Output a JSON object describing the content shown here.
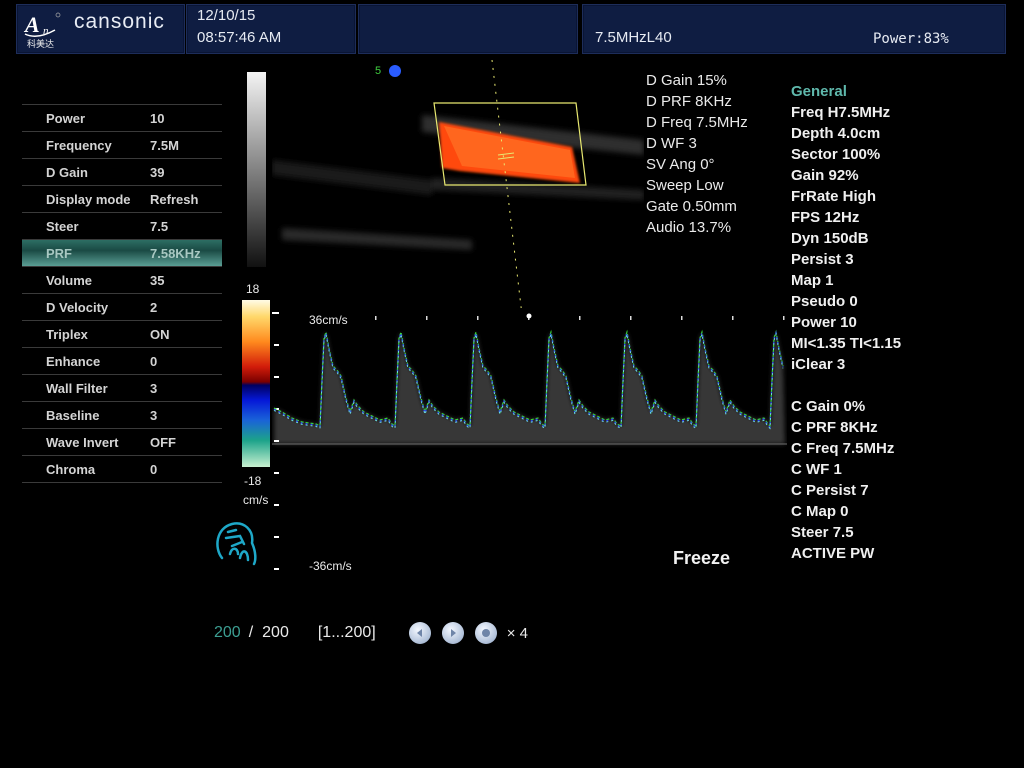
{
  "header": {
    "brand": "cansonic",
    "logo_sub": "科美达",
    "date": "12/10/15",
    "time": "08:57:46 AM",
    "probe": "7.5MHzL40",
    "power": "Power:83%"
  },
  "menu": {
    "items": [
      {
        "label": "Power",
        "value": "10"
      },
      {
        "label": "Frequency",
        "value": "7.5M"
      },
      {
        "label": "D Gain",
        "value": "39"
      },
      {
        "label": "Display mode",
        "value": "Refresh"
      },
      {
        "label": "Steer",
        "value": "7.5"
      },
      {
        "label": "PRF",
        "value": "7.58KHz",
        "selected": true
      },
      {
        "label": "Volume",
        "value": "35"
      },
      {
        "label": "D Velocity",
        "value": "2"
      },
      {
        "label": "Triplex",
        "value": "ON"
      },
      {
        "label": "Enhance",
        "value": "0"
      },
      {
        "label": "Wall Filter",
        "value": "3"
      },
      {
        "label": "Baseline",
        "value": "3"
      },
      {
        "label": "Wave Invert",
        "value": "OFF"
      },
      {
        "label": "Chroma",
        "value": "0"
      }
    ]
  },
  "bmode": {
    "frame_indicator": "5"
  },
  "doppler_params": [
    "D Gain 15%",
    "D PRF 8KHz",
    "D Freq 7.5MHz",
    "D WF 3",
    "SV Ang 0°",
    "Sweep Low",
    "Gate 0.50mm",
    "Audio 13.7%"
  ],
  "general_panel": {
    "title": "General",
    "items": [
      "Freq H7.5MHz",
      "Depth 4.0cm",
      "Sector 100%",
      "Gain 92%",
      "FrRate High",
      "FPS 12Hz",
      "Dyn 150dB",
      "Persist 3",
      "Map 1",
      "Pseudo 0",
      "Power 10",
      "MI<1.35  TI<1.15",
      "iClear 3"
    ],
    "color_items": [
      "C Gain 0%",
      "C PRF 8KHz",
      "C Freq 7.5MHz",
      "C WF 1",
      "C Persist 7",
      "C Map 0",
      "Steer 7.5",
      "ACTIVE PW"
    ]
  },
  "color_scale": {
    "max": "18",
    "min": "-18",
    "unit": "cm/s"
  },
  "spectrum": {
    "top_label": "36cm/s",
    "bottom_label": "-36cm/s"
  },
  "status": {
    "freeze": "Freeze"
  },
  "cine": {
    "current": "200",
    "separator": "/",
    "total": "200",
    "range": "[1...200]",
    "speed": "× 4",
    "buttons": [
      "prev",
      "next",
      "play"
    ]
  },
  "colors": {
    "header_bg": "#0f1d42",
    "accent_teal": "#5fb8ac",
    "selected_row": "#2d6e63",
    "flow_red": "#ff5a10",
    "roi_yellow": "#e8e870"
  }
}
